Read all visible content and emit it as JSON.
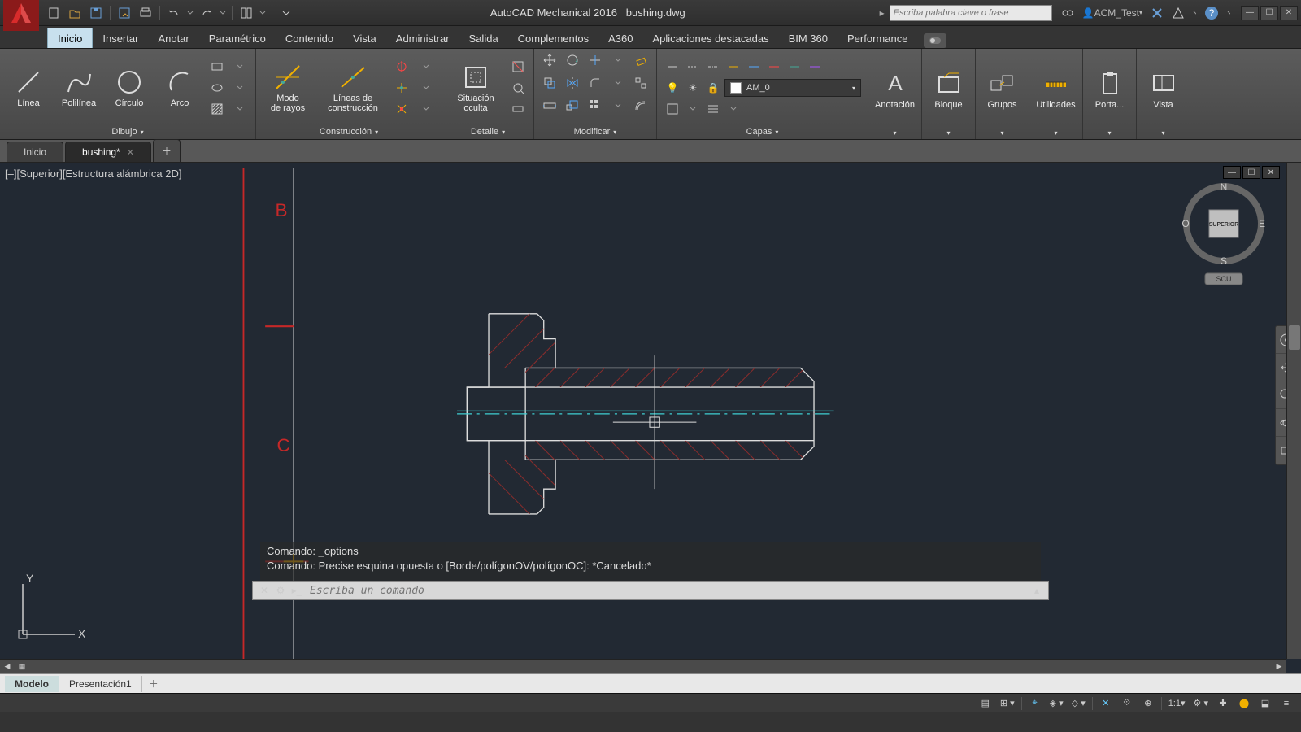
{
  "app": {
    "title": "AutoCAD Mechanical 2016",
    "doc": "bushing.dwg"
  },
  "search": {
    "placeholder": "Escriba palabra clave o frase"
  },
  "user": {
    "name": "ACM_Test"
  },
  "menu": {
    "tabs": [
      "Inicio",
      "Insertar",
      "Anotar",
      "Paramétrico",
      "Contenido",
      "Vista",
      "Administrar",
      "Salida",
      "Complementos",
      "A360",
      "Aplicaciones destacadas",
      "BIM 360",
      "Performance"
    ],
    "active": 0
  },
  "ribbon": {
    "draw": {
      "title": "Dibujo",
      "line": "Línea",
      "polyline": "Polilínea",
      "circle": "Círculo",
      "arc": "Arco"
    },
    "construction": {
      "title": "Construcción",
      "ray": "Modo\nde rayos",
      "clines": "Líneas de\nconstrucción"
    },
    "detail": {
      "title": "Detalle",
      "hidden": "Situación\noculta"
    },
    "modify": {
      "title": "Modificar"
    },
    "layers": {
      "title": "Capas",
      "current": "AM_0"
    },
    "annotation": {
      "title": "",
      "label": "Anotación"
    },
    "block": {
      "title": "",
      "label": "Bloque"
    },
    "groups": {
      "title": "",
      "label": "Grupos"
    },
    "utilities": {
      "title": "",
      "label": "Utilidades"
    },
    "clipboard": {
      "title": "",
      "label": "Porta..."
    },
    "view": {
      "title": "",
      "label": "Vista"
    }
  },
  "file_tabs": {
    "home": "Inicio",
    "doc": "bushing*"
  },
  "viewport": {
    "label": "[–][Superior][Estructura alámbrica 2D]"
  },
  "navcube": {
    "n": "N",
    "s": "S",
    "e": "E",
    "w": "O",
    "face": "SUPERIOR",
    "scu": "SCU"
  },
  "ucs": {
    "y": "Y",
    "x": "X"
  },
  "command": {
    "hist1": "Comando: _options",
    "hist2": "Comando: Precise esquina opuesta o [Borde/polígonOV/polígonOC]: *Cancelado*",
    "placeholder": "Escriba un comando"
  },
  "model_tabs": {
    "model": "Modelo",
    "layout1": "Presentación1"
  },
  "status": {
    "scale": "1:1"
  }
}
